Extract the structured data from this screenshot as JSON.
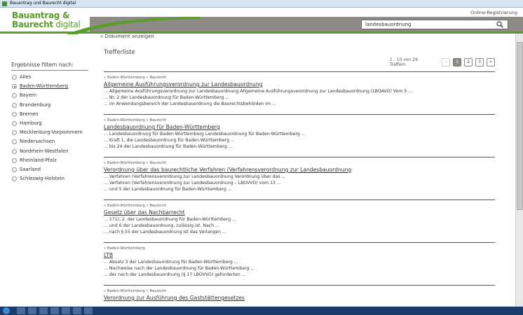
{
  "window": {
    "title": "Bauantrag und Baurecht digital"
  },
  "logo": {
    "line1": "Bauantrag &",
    "line2_bold": "Baurecht",
    "line2_rest": " digital"
  },
  "header": {
    "online_registration": "Online-Registrierung"
  },
  "search": {
    "value": "landesbauordnung"
  },
  "nav": {
    "back_link": "« Dokument anzeigen"
  },
  "sidebar": {
    "title": "Ergebnisse filtern nach:",
    "items": [
      {
        "label": "Alles",
        "selected": false
      },
      {
        "label": "Baden-Württemberg",
        "selected": true
      },
      {
        "label": "Bayern",
        "selected": false
      },
      {
        "label": "Brandenburg",
        "selected": false
      },
      {
        "label": "Bremen",
        "selected": false
      },
      {
        "label": "Hamburg",
        "selected": false
      },
      {
        "label": "Mecklenburg-Vorpommern",
        "selected": false
      },
      {
        "label": "Niedersachsen",
        "selected": false
      },
      {
        "label": "Nordrhein-Westfalen",
        "selected": false
      },
      {
        "label": "Rheinland-Pfalz",
        "selected": false
      },
      {
        "label": "Saarland",
        "selected": false
      },
      {
        "label": "Schleswig-Holstein",
        "selected": false
      }
    ]
  },
  "main": {
    "heading": "Trefferliste",
    "pager": {
      "summary": "1 - 10 von 29 Treffern",
      "first": "«",
      "pages": [
        "1",
        "2",
        "3"
      ],
      "current": "1",
      "last": "»"
    },
    "results": [
      {
        "crumbs": [
          "Baden-Württemberg",
          "Baurecht"
        ],
        "title": "Allgemeine Ausführungsverordnung zur Landesbauordnung",
        "snippets": [
          "... Allgemeine Ausführungsverordnung zur Landesbauordnung Allgemeine Ausführungsverordnung zur Landesbauordnung (LBOAVO) Vom 5 ...",
          "... Nr. 2 der Landesbauordnung für Baden-Württemberg ...",
          "... im Anwendungsbereich der Landesbauordnung die Baurechtsbehörden im ..."
        ]
      },
      {
        "crumbs": [
          "Baden-Württemberg",
          "Baurecht"
        ],
        "title": "Landesbauordnung für Baden-Württemberg",
        "snippets": [
          "... Landesbauordnung für Baden-Württemberg Landesbauordnung für Baden-Württemberg ...",
          "... Kraft 1. die Landesbauordnung für Baden-Württemberg ...",
          "... bis 24 der Landesbauordnung für Baden-Württemberg ..."
        ]
      },
      {
        "crumbs": [
          "Baden-Württemberg",
          "Baurecht"
        ],
        "title": "Verordnung über das baurechtliche Verfahren (Verfahrensverordnung zur Landesbauordnung",
        "snippets": [
          "... Verfahren (Verfahrensverordnung zur Landesbauordnung Verordnung über das ...",
          "... Verfahren (Verfahrensverordnung zur Landesbauordnung – LBOVVO) vom 13 ...",
          "... und 5 der Landesbauordnung für Baden-Württemberg ..."
        ]
      },
      {
        "crumbs": [
          "Baden-Württemberg",
          "Baurecht"
        ],
        "title": "Gesetz über das Nachbarrecht",
        "snippets": [
          "... 171), 2. der Landesbauordnung für Baden-Württemberg ...",
          "... und 6 der Landesbauordnung, zulässig ist. Nach ...",
          "... nach § 55 der Landesbauordnung ist das Verlangen ..."
        ]
      },
      {
        "crumbs": [
          "Baden-Württemberg"
        ],
        "title": "LTB",
        "snippets": [
          "... Absatz 3 der Landesbauordnung für Baden-Württemberg ...",
          "... Nachweise nach der Landesbauordnung für Baden-Württemberg ...",
          "... der nach der Landesbauordnung (§ 17 LBOVVO) geforderten ..."
        ]
      },
      {
        "crumbs": [
          "Baden-Württemberg",
          "Baurecht"
        ],
        "title": "Verordnung zur Ausführung des Gaststättengesetzes",
        "snippets": []
      }
    ]
  },
  "colors": {
    "brand_green": "#5a9e2a",
    "header_gray": "#8e8a86"
  }
}
